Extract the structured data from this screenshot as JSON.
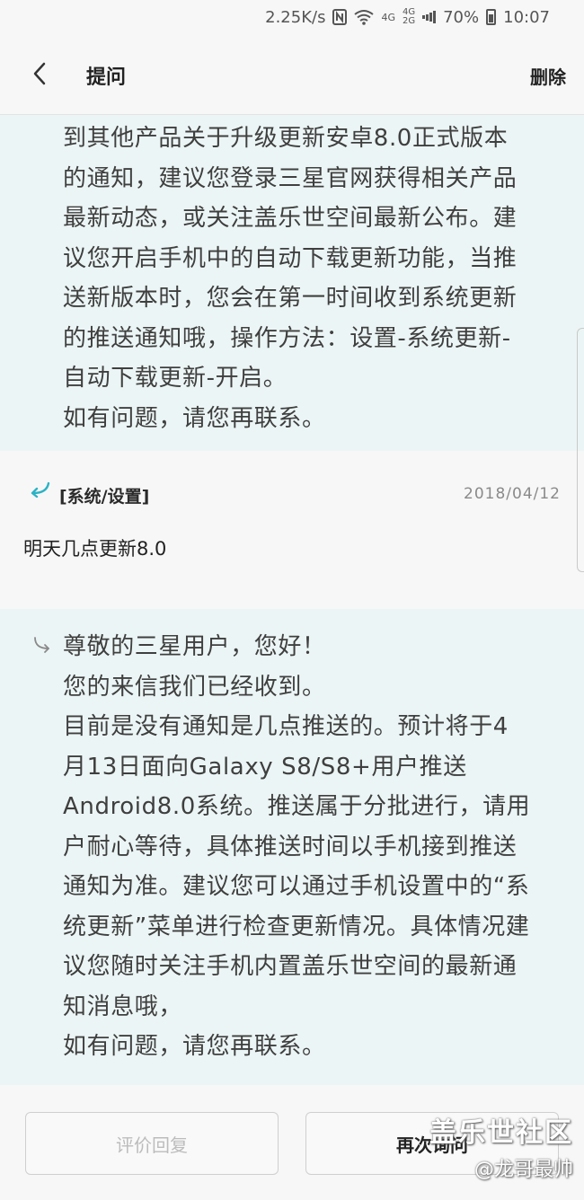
{
  "status_bar": {
    "speed": "2.25K/s",
    "net_top": "4G",
    "net_bottom_a": "4G",
    "net_bottom_b": "2G",
    "battery": "70%",
    "time": "10:07",
    "icons": [
      "nfc-icon",
      "wifi-icon",
      "signal-icon",
      "battery-icon"
    ]
  },
  "header": {
    "title": "提问",
    "delete_label": "删除"
  },
  "first_reply": {
    "lines": [
      "到其他产品关于升级更新安卓8.0正式版本",
      "的通知，建议您登录三星官网获得相关产品",
      "最新动态，或关注盖乐世空间最新公布。建",
      "议您开启手机中的自动下载更新功能，当推",
      "送新版本时，您会在第一时间收到系统更新",
      "的推送通知哦，操作方法：设置-系统更新-",
      "自动下载更新-开启。",
      "如有问题，请您再联系。"
    ]
  },
  "question": {
    "category": "[系统/设置]",
    "date": "2018/04/12",
    "text": "明天几点更新8.0"
  },
  "second_reply": {
    "lines": [
      "尊敬的三星用户，您好！",
      "您的来信我们已经收到。",
      "目前是没有通知是几点推送的。预计将于4",
      "月13日面向Galaxy S8/S8+用户推送",
      "Android8.0系统。推送属于分批进行，请用",
      "户耐心等待，具体推送时间以手机接到推送",
      "通知为准。建议您可以通过手机设置中的“系",
      "统更新”菜单进行检查更新情况。具体情况建",
      "议您随时关注手机内置盖乐世空间的最新通",
      "知消息哦，",
      "如有问题，请您再联系。"
    ]
  },
  "bottom": {
    "rate_label": "评价回复",
    "ask_label": "再次询问"
  },
  "watermark": {
    "brand": "盖乐世社区",
    "user": "@龙哥最帅"
  },
  "colors": {
    "reply_bg": "#ecf5f5",
    "page_bg": "#f7f7f7",
    "accent_teal": "#2bb3c4"
  }
}
